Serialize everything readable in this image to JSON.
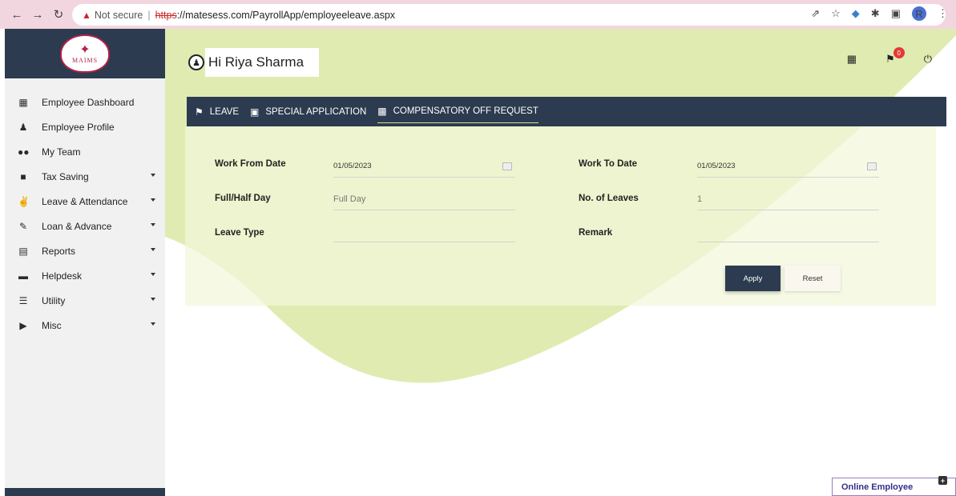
{
  "browser": {
    "not_secure": "Not secure",
    "scheme": "https",
    "url_rest": "://matesess.com/PayrollApp/employeeleave.aspx",
    "profile_initial": "R"
  },
  "logo": {
    "text": "MAIMS"
  },
  "sidebar": {
    "items": [
      {
        "label": "Employee Dashboard",
        "icon": "dashboard-icon"
      },
      {
        "label": "Employee Profile",
        "icon": "person-icon"
      },
      {
        "label": "My Team",
        "icon": "team-icon"
      },
      {
        "label": "Tax Saving",
        "icon": "book-icon"
      },
      {
        "label": "Leave & Attendance",
        "icon": "thumbs-up-icon"
      },
      {
        "label": "Loan & Advance",
        "icon": "edit-icon"
      },
      {
        "label": "Reports",
        "icon": "report-icon"
      },
      {
        "label": "Helpdesk",
        "icon": "laptop-icon"
      },
      {
        "label": "Utility",
        "icon": "list-icon"
      },
      {
        "label": "Misc",
        "icon": "megaphone-icon"
      }
    ]
  },
  "header": {
    "greeting": "Hi Riya Sharma",
    "notification_count": "0"
  },
  "tabs": [
    {
      "label": "LEAVE",
      "icon": "flag-icon"
    },
    {
      "label": "SPECIAL APPLICATION",
      "icon": "tablet-icon"
    },
    {
      "label": "COMPENSATORY OFF REQUEST",
      "icon": "chat-icon",
      "active": true
    }
  ],
  "form": {
    "work_from_date_label": "Work From Date",
    "work_from_date_value": "01/05/2023",
    "work_to_date_label": "Work To Date",
    "work_to_date_value": "01/05/2023",
    "full_half_day_label": "Full/Half Day",
    "full_half_day_value": "Full Day",
    "no_of_leaves_label": "No. of Leaves",
    "no_of_leaves_value": "1",
    "leave_type_label": "Leave Type",
    "leave_type_value": "",
    "remark_label": "Remark",
    "remark_value": "",
    "apply_label": "Apply",
    "reset_label": "Reset"
  },
  "footer": {
    "online_employee": "Online Employee"
  },
  "colors": {
    "navy": "#2c3b4f",
    "accent_green": "#d8e59a",
    "badge_red": "#e53935"
  }
}
